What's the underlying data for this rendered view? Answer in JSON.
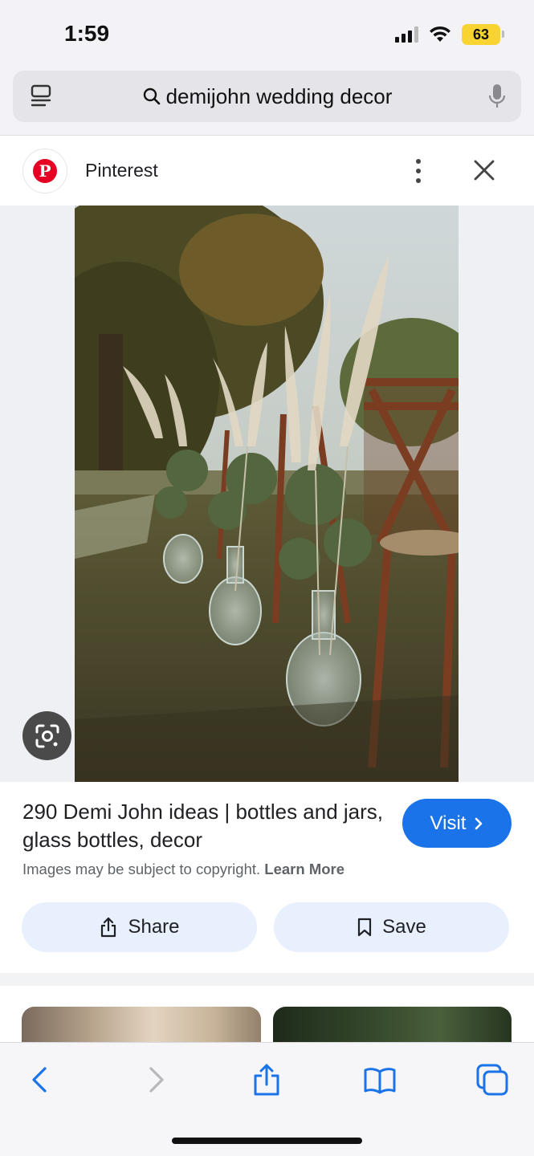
{
  "status": {
    "time": "1:59",
    "battery": "63"
  },
  "address_bar": {
    "query": "demijohn wedding decor"
  },
  "source": {
    "name": "Pinterest",
    "logo_letter": "P"
  },
  "result": {
    "title": "290 Demi John ideas | bottles and jars, glass bottles, decor",
    "visit_label": "Visit",
    "copyright_text": "Images may be subject to copyright.",
    "learn_more": "Learn More",
    "share_label": "Share",
    "save_label": "Save"
  },
  "colors": {
    "accent": "#1a73e8",
    "pinterest_red": "#e60023",
    "battery_yellow": "#f7d432",
    "chip_bg": "#e8f0fe",
    "toolbar_blue": "#1a73e8"
  },
  "icons": {
    "tabs": "tab-overview-icon",
    "search": "search-icon",
    "mic": "microphone-icon",
    "more": "more-vertical-icon",
    "close": "close-icon",
    "lens": "google-lens-icon",
    "share": "share-icon",
    "save": "bookmark-icon",
    "back": "back-icon",
    "forward": "forward-icon",
    "bookmarks": "bookmarks-book-icon",
    "tab_switcher": "tab-switcher-icon"
  }
}
